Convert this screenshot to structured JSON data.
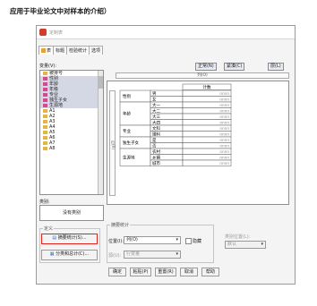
{
  "caption": "应用于毕业论文中对样本的介绍）",
  "dialog": {
    "title": "定制表",
    "tabs": [
      "表",
      "标题",
      "检验统计",
      "选项"
    ],
    "variables_label": "变量(V):",
    "variables": [
      "被排号",
      "性别",
      "年龄",
      "年级",
      "专业",
      "独生子女",
      "生源地",
      "A1",
      "A2",
      "A3",
      "A4",
      "A5",
      "A6",
      "A7",
      "A8"
    ],
    "selected_variables": [
      "性别",
      "年龄",
      "年级",
      "专业",
      "独生子女",
      "生源地"
    ],
    "category_label": "类别:",
    "category_value": "没有类别",
    "normal_button": "正常(N)",
    "compact_button": "紧凑(C)",
    "layers_button": "层(L)",
    "column_header": "列(O)",
    "row_header": "行(R)",
    "table": {
      "count_header": "计数",
      "rows": [
        {
          "group": "性别",
          "items": [
            "男",
            "女"
          ]
        },
        {
          "group": "年龄",
          "items": [
            "大一",
            "大二",
            "大三",
            "大四"
          ]
        },
        {
          "group": "专业",
          "items": [
            "文科",
            "理科"
          ]
        },
        {
          "group": "独生子女",
          "items": [
            "是",
            "否"
          ]
        },
        {
          "group": "生源地",
          "items": [
            "农村",
            "乡镇",
            "城市"
          ]
        }
      ],
      "cell_value": "nnnn"
    },
    "define_label": "定义",
    "summary_stats_button": "摘要统计(S)...",
    "categories_totals_button": "分类和总计(C)...",
    "summary_group_label": "摘要统计",
    "position_label": "位置(I):",
    "position_value": "列(O)",
    "hide_label": "隐藏",
    "source_label": "源(U):",
    "source_value": "行变量",
    "category_position_label": "类别位置(L):",
    "category_position_value": "默认",
    "buttons": [
      "确定",
      "粘贴(P)",
      "重置(R)",
      "取消",
      "帮助"
    ]
  }
}
